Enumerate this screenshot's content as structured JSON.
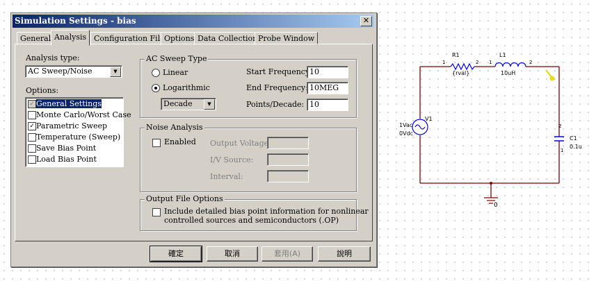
{
  "dialog": {
    "title": "Simulation Settings - bias",
    "close_glyph": "✕",
    "tabs": [
      "General",
      "Analysis",
      "Configuration Files",
      "Options",
      "Data Collection",
      "Probe Window"
    ],
    "active_tab": "Analysis",
    "analysis_type_label": "Analysis type:",
    "analysis_type_value": "AC Sweep/Noise",
    "options_label": "Options:",
    "options_items": [
      {
        "label": "General Settings",
        "checked": true,
        "selected": true
      },
      {
        "label": "Monte Carlo/Worst Case",
        "checked": false
      },
      {
        "label": "Parametric Sweep",
        "checked": true
      },
      {
        "label": "Temperature (Sweep)",
        "checked": false
      },
      {
        "label": "Save Bias Point",
        "checked": false
      },
      {
        "label": "Load Bias Point",
        "checked": false
      }
    ],
    "ac_sweep": {
      "title": "AC Sweep Type",
      "linear_label": "Linear",
      "log_label": "Logarithmic",
      "log_selected": true,
      "decade_value": "Decade",
      "start_label": "Start Frequency:",
      "start_value": "10",
      "end_label": "End Frequency:",
      "end_value": "10MEG",
      "points_label": "Points/Decade:",
      "points_value": "10"
    },
    "noise": {
      "title": "Noise Analysis",
      "enabled_label": "Enabled",
      "output_voltage_label": "Output Voltage:",
      "iv_source_label": "I/V Source:",
      "interval_label": "Interval:"
    },
    "output": {
      "title": "Output File Options",
      "include_label_line1": "Include detailed bias point information for nonlinear",
      "include_label_line2": "controlled sources and semiconductors (.OP)"
    },
    "buttons": {
      "ok": "確定",
      "cancel": "取消",
      "apply": "套用(A)",
      "help": "說明"
    }
  },
  "schematic": {
    "r1_name": "R1",
    "r1_value": "{rval}",
    "l1_name": "L1",
    "l1_value": "10uH",
    "v1_name": "V1",
    "v1_ac": "1Vac",
    "v1_dc": "0Vdc",
    "c1_name": "C1",
    "c1_value": "0.1u",
    "ground_label": "0",
    "pin_1": "1",
    "pin_2": "2",
    "wire_color": "#800000",
    "part_color": "#0000ff",
    "marker_color": "#f0e000"
  }
}
